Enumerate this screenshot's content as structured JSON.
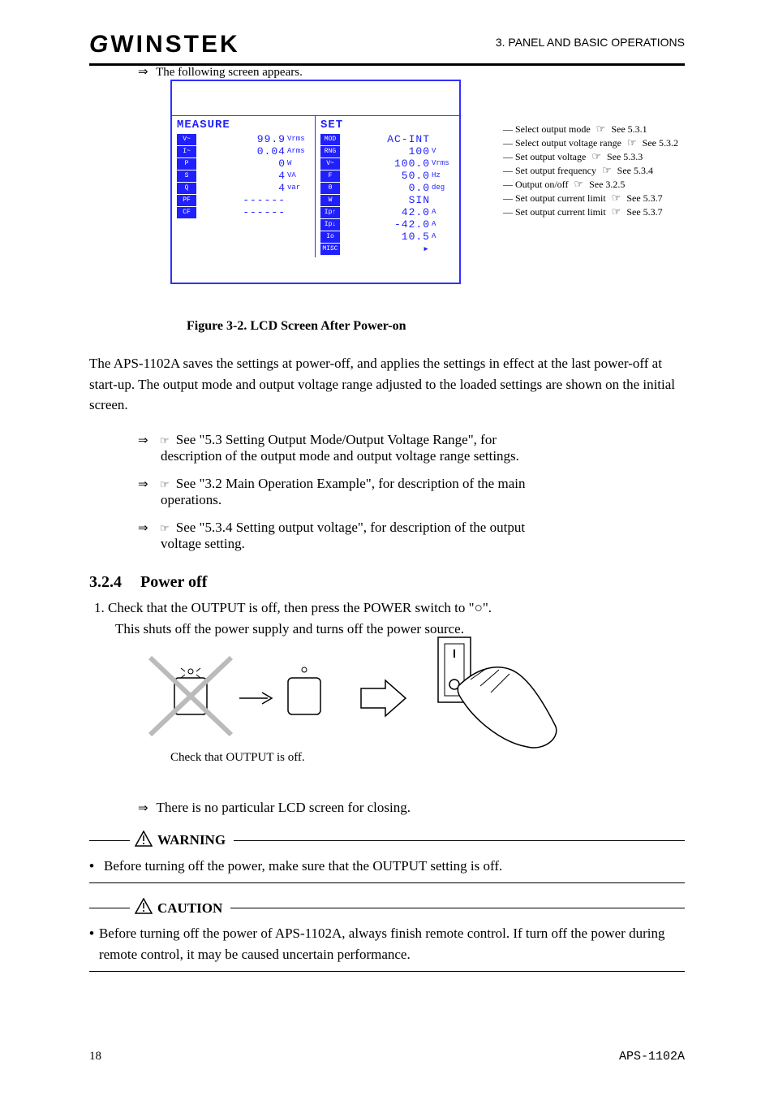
{
  "brand": "GWINSTEK",
  "headerRight": "3. PANEL AND BASIC OPERATIONS",
  "intro_arrow": "The following screen appears.",
  "lcd": {
    "left": {
      "title": "MEASURE",
      "rows": [
        {
          "tag": "V~",
          "val": "99.9",
          "unit": "Vrms"
        },
        {
          "tag": "I~",
          "val": "0.04",
          "unit": "Arms"
        },
        {
          "tag": "P",
          "val": "0",
          "unit": "W"
        },
        {
          "tag": "S",
          "val": "4",
          "unit": "VA"
        },
        {
          "tag": "Q",
          "val": "4",
          "unit": "var"
        },
        {
          "tag": "PF",
          "val": "------",
          "unit": ""
        },
        {
          "tag": "CF",
          "val": "------",
          "unit": ""
        }
      ]
    },
    "right": {
      "title": "SET",
      "rows": [
        {
          "tag": "MOD",
          "val": "AC-INT",
          "unit": ""
        },
        {
          "tag": "RNG",
          "val": "100",
          "unit": "V"
        },
        {
          "tag": "V~",
          "val": "100.0",
          "unit": "Vrms"
        },
        {
          "tag": "F",
          "val": "50.0",
          "unit": "Hz"
        },
        {
          "tag": "θ",
          "val": "0.0",
          "unit": "deg"
        },
        {
          "tag": "W",
          "val": "SIN",
          "unit": ""
        },
        {
          "tag": "Ip↑",
          "val": "42.0",
          "unit": "A"
        },
        {
          "tag": "Ip↓",
          "val": "-42.0",
          "unit": "A"
        },
        {
          "tag": "Io",
          "val": "10.5",
          "unit": "A"
        },
        {
          "tag": "MISC",
          "val": "▸",
          "unit": ""
        }
      ]
    },
    "callouts": [
      "Select output mode",
      "Select output voltage range",
      "Set output voltage",
      "Set output frequency",
      "Output on/off",
      "Set output current limit",
      "Set output current limit"
    ],
    "refs": [
      "See 5.3.1",
      "See 5.3.2",
      "See 5.3.3",
      "See 5.3.4",
      "See 3.2.5",
      "See 5.3.7",
      "See 5.3.7"
    ]
  },
  "figCaption": "Figure 3-2. LCD Screen After Power-on",
  "para": "The APS-1102A saves the settings at power-off, and applies the settings in effect at the last power-off at start-up. The output mode and output voltage range adjusted to the loaded settings are shown on the initial screen.",
  "seeRefs": [
    {
      "l1": "See \"5.3 Setting Output Mode/Output Voltage Range\", for",
      "l2": "description of the output mode and output voltage range settings."
    },
    {
      "l1": "See \"3.2 Main Operation Example\", for description of the main",
      "l2": "operations."
    },
    {
      "l1": "See \"5.3.4 Setting output voltage\", for description of the output",
      "l2": "voltage setting."
    }
  ],
  "sec": {
    "num": "3.2.4",
    "title": "Power off"
  },
  "steps": {
    "s1": "1.  Check that the OUTPUT is off, then press the POWER switch to \"○\".",
    "s1_after": "This shuts off the power supply and turns off the power source."
  },
  "off_text": "Check that OUTPUT is off.",
  "note": "There is no particular LCD screen for closing.",
  "warn_label": "WARNING",
  "warn_text": "Before turning off the power, make sure that the OUTPUT setting is off.",
  "caution_label": "CAUTION",
  "caution_text": "Before turning off the power of APS-1102A, always finish remote control. If turn off the power during remote control, it may be caused uncertain performance.",
  "pageNum": "18",
  "footerModel": "APS-1102A"
}
